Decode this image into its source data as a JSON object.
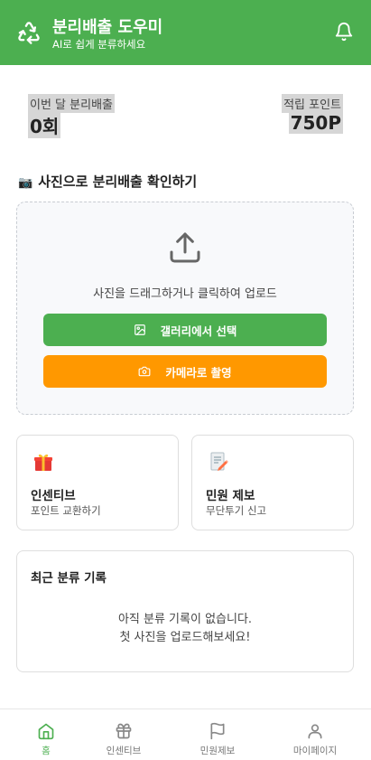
{
  "header": {
    "title": "분리배출 도우미",
    "subtitle": "AI로 쉽게 분류하세요",
    "logo_icon": "recycle-icon",
    "notification_icon": "bell-icon"
  },
  "stats": {
    "monthly_label": "이번 달 분리배출",
    "monthly_value": "0회",
    "points_label": "적립 포인트",
    "points_value": "750P"
  },
  "upload_section": {
    "title": "사진으로 분리배출 확인하기",
    "title_icon": "camera-icon",
    "hint": "사진을 드래그하거나 클릭하여 업로드",
    "gallery_button": "갤러리에서 선택",
    "camera_button": "카메라로 촬영"
  },
  "cards": [
    {
      "icon": "gift-icon",
      "title": "인센티브",
      "subtitle": "포인트 교환하기"
    },
    {
      "icon": "memo-icon",
      "title": "민원 제보",
      "subtitle": "무단투기 신고"
    }
  ],
  "recent": {
    "title": "최근 분류 기록",
    "empty_line1": "아직 분류 기록이 없습니다.",
    "empty_line2": "첫 사진을 업로드해보세요!"
  },
  "bottom_nav": [
    {
      "icon": "home-icon",
      "label": "홈",
      "active": true
    },
    {
      "icon": "gift-icon",
      "label": "인센티브",
      "active": false
    },
    {
      "icon": "flag-icon",
      "label": "민원제보",
      "active": false
    },
    {
      "icon": "user-icon",
      "label": "마이페이지",
      "active": false
    }
  ],
  "colors": {
    "primary": "#4caf50",
    "accent": "#ff9800",
    "stat_highlight": "#d6d6d6"
  }
}
